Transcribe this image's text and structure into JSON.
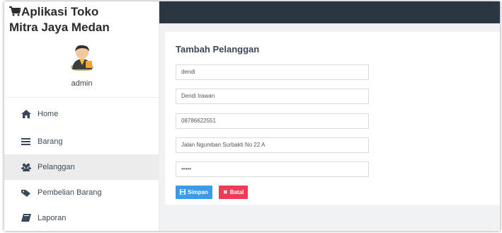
{
  "app": {
    "brand_line1": "Aplikasi Toko",
    "brand_line2": "Mitra Jaya Medan",
    "user": "admin"
  },
  "sidebar": {
    "items": [
      {
        "label": "Home",
        "icon": "home-icon"
      },
      {
        "label": "Barang",
        "icon": "list-icon"
      },
      {
        "label": "Pelanggan",
        "icon": "users-icon",
        "active": true
      },
      {
        "label": "Pembelian Barang",
        "icon": "tag-icon"
      },
      {
        "label": "Laporan",
        "icon": "book-icon"
      }
    ]
  },
  "form": {
    "title": "Tambah Pelanggan",
    "fields": [
      {
        "name": "username",
        "value": "dendi"
      },
      {
        "name": "nama",
        "value": "Dendi Irawan"
      },
      {
        "name": "telepon",
        "value": "08786622551"
      },
      {
        "name": "alamat",
        "value": "Jalan Ngumban Surbakti No 22 A"
      },
      {
        "name": "password",
        "value": "•••••"
      }
    ],
    "save_label": "Simpan",
    "cancel_label": "Batal"
  },
  "colors": {
    "topbar": "#2b3643",
    "save": "#3c9be8",
    "cancel": "#ee3b57",
    "active_menu": "#ececec"
  }
}
